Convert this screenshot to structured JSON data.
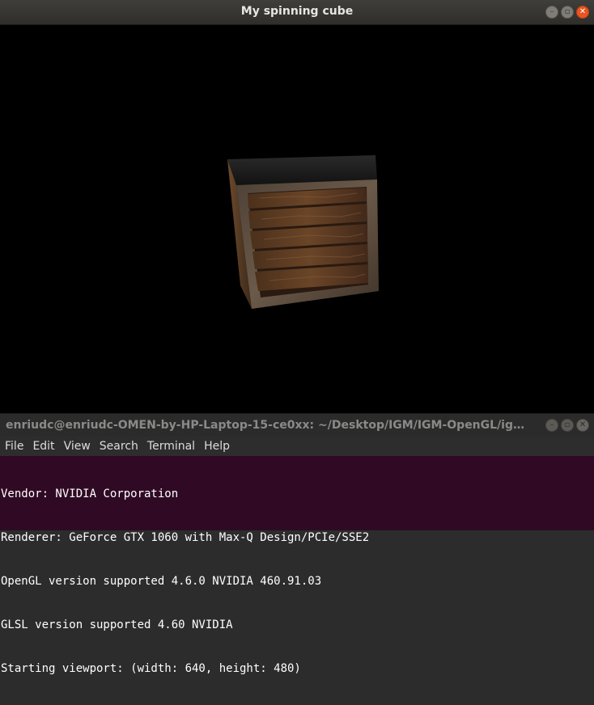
{
  "gl_window": {
    "title": "My spinning cube",
    "controls": [
      "minimize",
      "maximize",
      "close"
    ]
  },
  "terminal": {
    "title": "enriudc@enriudc-OMEN-by-HP-Laptop-15-ce0xx: ~/Desktop/IGM/IGM-OpenGL/igm-opengl_...",
    "menu": [
      "File",
      "Edit",
      "View",
      "Search",
      "Terminal",
      "Help"
    ],
    "lines": [
      "Vendor: NVIDIA Corporation",
      "Renderer: GeForce GTX 1060 with Max-Q Design/PCIe/SSE2",
      "OpenGL version supported 4.6.0 NVIDIA 460.91.03",
      "GLSL version supported 4.60 NVIDIA",
      "Starting viewport: (width: 640, height: 480)"
    ]
  },
  "colors": {
    "terminal_bg": "#300a24",
    "close_button": "#e95420",
    "canvas_bg": "#000000"
  },
  "icons": [
    "minimize-icon",
    "maximize-icon",
    "close-icon"
  ]
}
